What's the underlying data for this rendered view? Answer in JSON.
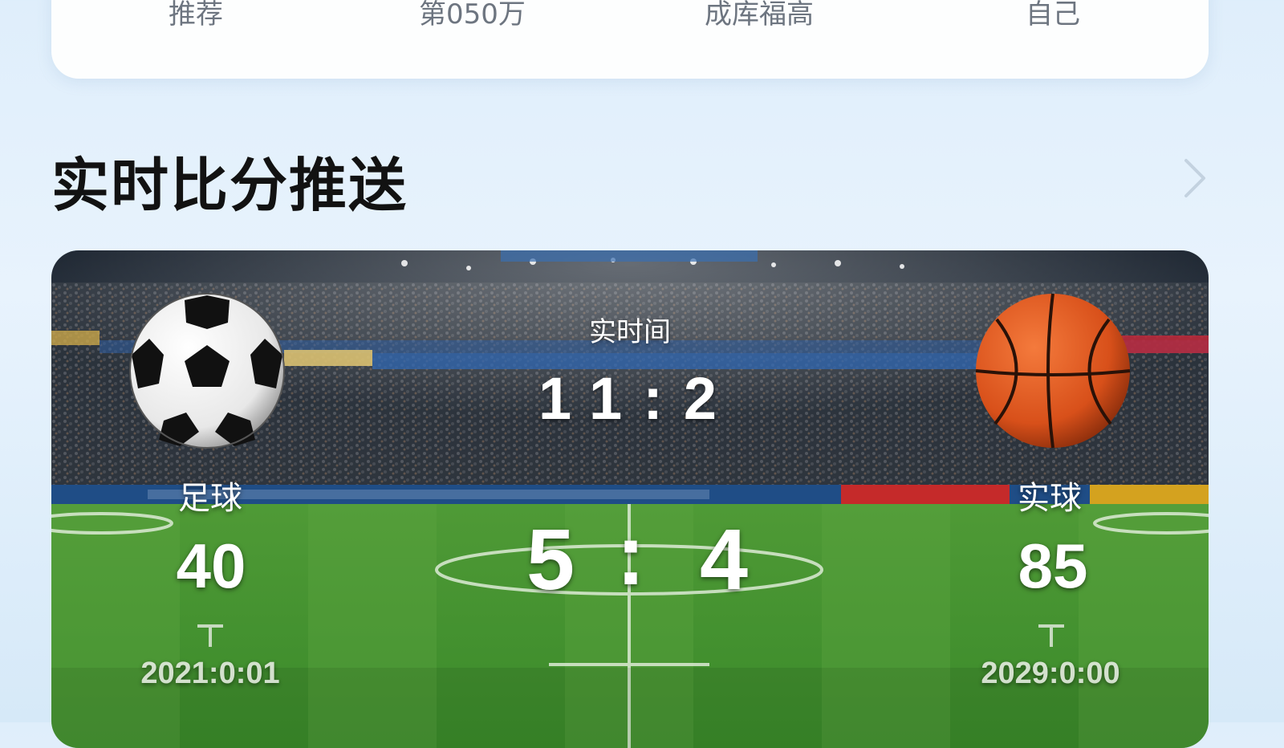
{
  "nav": {
    "tabs": [
      {
        "label": "推荐"
      },
      {
        "label": "第050万"
      },
      {
        "label": "成库福高"
      },
      {
        "label": "自己"
      }
    ]
  },
  "section": {
    "title": "实时比分推送",
    "more_icon": "chevron-right-icon"
  },
  "scoreboard": {
    "time_label": "实时间",
    "clock": "11:2",
    "score_home": "5",
    "score_separator": ":",
    "score_away": "4",
    "home": {
      "icon": "soccer-ball-icon",
      "name": "足球",
      "points": "40",
      "time": "2021:0:01"
    },
    "away": {
      "icon": "basketball-icon",
      "name": "实球",
      "points": "85",
      "time": "2029:0:00"
    }
  },
  "colors": {
    "pitch_green": "#3f8f2f",
    "basketball_orange": "#e0541c",
    "title_text": "#121212"
  }
}
